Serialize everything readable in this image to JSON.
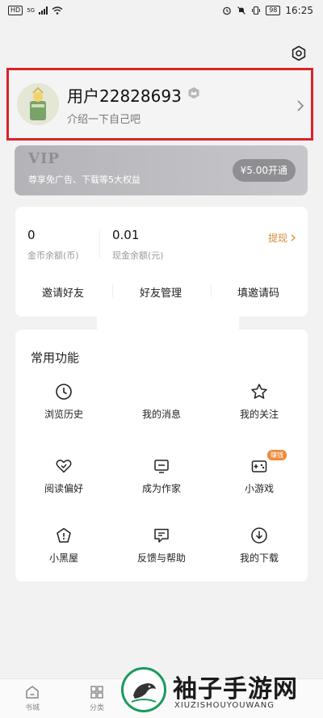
{
  "status_bar": {
    "hd": "HD",
    "net": "5G",
    "battery": "98",
    "time": "16:25"
  },
  "profile": {
    "username": "用户22828693",
    "bio": "介绍一下自己吧"
  },
  "vip": {
    "title": "VIP",
    "description": "尊享免广告、下载等5大权益",
    "button": "¥5.00开通"
  },
  "wallet": {
    "coins_value": "0",
    "coins_label": "金币余额(币)",
    "cash_value": "0.01",
    "cash_label": "现金余额(元)",
    "withdraw": "提现",
    "actions": [
      "邀请好友",
      "好友管理",
      "填邀请码"
    ]
  },
  "functions": {
    "title": "常用功能",
    "items": [
      {
        "label": "浏览历史",
        "icon": "clock-icon"
      },
      {
        "label": "我的消息",
        "icon": "message-icon"
      },
      {
        "label": "我的关注",
        "icon": "star-icon"
      },
      {
        "label": "阅读偏好",
        "icon": "heart-icon"
      },
      {
        "label": "成为作家",
        "icon": "writer-icon"
      },
      {
        "label": "小游戏",
        "icon": "gamepad-icon",
        "badge": "赚钱"
      },
      {
        "label": "小黑屋",
        "icon": "house-icon"
      },
      {
        "label": "反馈与帮助",
        "icon": "feedback-icon"
      },
      {
        "label": "我的下载",
        "icon": "download-icon"
      }
    ]
  },
  "bottom_nav": {
    "items": [
      {
        "label": "书城",
        "icon": "home-icon"
      },
      {
        "label": "分类",
        "icon": "grid-icon"
      }
    ]
  },
  "watermark": {
    "text": "袖子手游网",
    "sub": "XIUZISHOUYOUWANG"
  },
  "colors": {
    "highlight_border": "#d9232a",
    "withdraw": "#d68b3e",
    "earn_badge": "#f08a3c",
    "watermark_green": "#1a9a5a"
  }
}
